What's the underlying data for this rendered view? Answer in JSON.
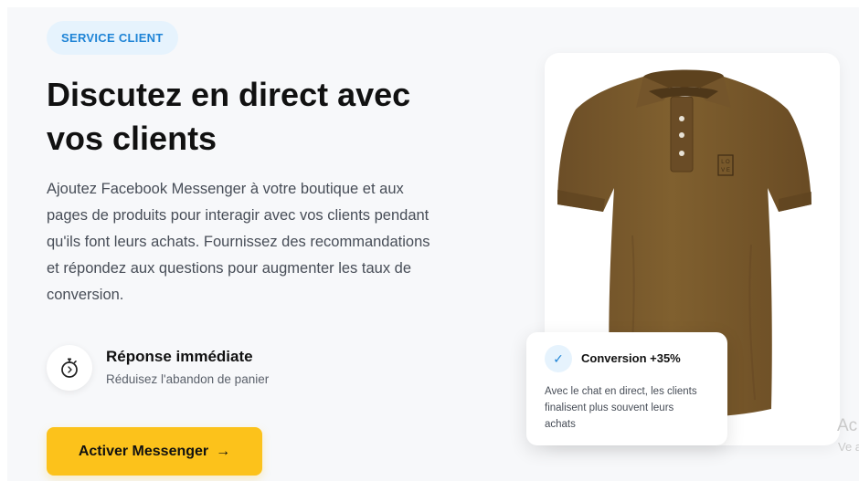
{
  "badge": "SERVICE CLIENT",
  "headline": {
    "line1": "Discutez en direct avec",
    "line2": "vos clients"
  },
  "description": {
    "line1": "Ajoutez Facebook Messenger à votre boutique et aux",
    "line2": "pages de produits pour interagir avec vos clients pendant",
    "line3": "qu'ils font leurs achats. Fournissez des recommandations",
    "line4": "et répondez aux questions pour augmenter les taux de",
    "line5": "conversion."
  },
  "feature": {
    "icon": "stopwatch-icon",
    "title": "Réponse immédiate",
    "subtitle": "Réduisez l'abandon de panier"
  },
  "cta": {
    "label": "Activer Messenger",
    "arrow": "→"
  },
  "product": {
    "image": "brown-polo-shirt",
    "color": "#7a5a30",
    "logo_text": "LOVE"
  },
  "stat": {
    "icon": "check-icon",
    "check_glyph": "✓",
    "title": "Conversion +35%",
    "line1": "Avec le chat en direct, les clients",
    "line2": "finalisent plus souvent leurs",
    "line3": "achats"
  },
  "watermark": {
    "line1": "Ac",
    "line2": "Ve a"
  },
  "colors": {
    "accent_blue": "#1f84d6",
    "badge_bg": "#e6f3fd",
    "cta_yellow": "#fcc21b",
    "section_bg": "#f7f8fa"
  }
}
